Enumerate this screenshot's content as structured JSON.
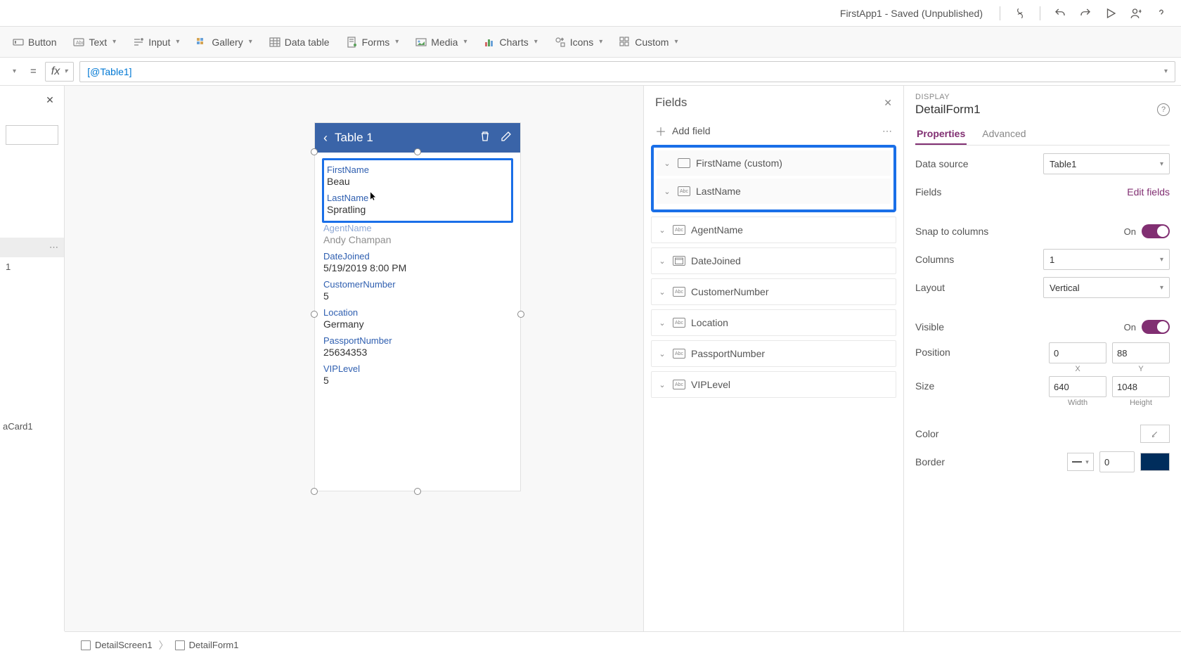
{
  "title_bar": {
    "app_title": "FirstApp1 - Saved (Unpublished)"
  },
  "ribbon": {
    "button": "Button",
    "text": "Text",
    "input": "Input",
    "gallery": "Gallery",
    "data_table": "Data table",
    "forms": "Forms",
    "media": "Media",
    "charts": "Charts",
    "icons": "Icons",
    "custom": "Custom"
  },
  "formula_bar": {
    "fx": "fx",
    "formula": "[@Table1]"
  },
  "left_panel": {
    "tree_item_1": "1",
    "tree_item_card": "aCard1"
  },
  "canvas": {
    "title": "Table 1",
    "cards": [
      {
        "label": "FirstName",
        "value": "Beau"
      },
      {
        "label": "LastName",
        "value": "Spratling"
      },
      {
        "label": "AgentName",
        "value": "Andy Champan"
      },
      {
        "label": "DateJoined",
        "value": "5/19/2019 8:00 PM"
      },
      {
        "label": "CustomerNumber",
        "value": "5"
      },
      {
        "label": "Location",
        "value": "Germany"
      },
      {
        "label": "PassportNumber",
        "value": "25634353"
      },
      {
        "label": "VIPLevel",
        "value": "5"
      }
    ]
  },
  "fields_panel": {
    "title": "Fields",
    "add_field": "Add field",
    "items": [
      {
        "name": "FirstName (custom)",
        "type": "custom"
      },
      {
        "name": "LastName",
        "type": "abc"
      },
      {
        "name": "AgentName",
        "type": "abc"
      },
      {
        "name": "DateJoined",
        "type": "date"
      },
      {
        "name": "CustomerNumber",
        "type": "abc"
      },
      {
        "name": "Location",
        "type": "abc"
      },
      {
        "name": "PassportNumber",
        "type": "abc"
      },
      {
        "name": "VIPLevel",
        "type": "abc"
      }
    ]
  },
  "props_panel": {
    "display_label": "DISPLAY",
    "name": "DetailForm1",
    "tabs": {
      "properties": "Properties",
      "advanced": "Advanced"
    },
    "data_source": {
      "label": "Data source",
      "value": "Table1"
    },
    "fields": {
      "label": "Fields",
      "edit": "Edit fields"
    },
    "snap": {
      "label": "Snap to columns",
      "value": "On"
    },
    "columns": {
      "label": "Columns",
      "value": "1"
    },
    "layout": {
      "label": "Layout",
      "value": "Vertical"
    },
    "visible": {
      "label": "Visible",
      "value": "On"
    },
    "position": {
      "label": "Position",
      "x": "0",
      "y": "88",
      "xlabel": "X",
      "ylabel": "Y"
    },
    "size": {
      "label": "Size",
      "w": "640",
      "h": "1048",
      "wlabel": "Width",
      "hlabel": "Height"
    },
    "color": {
      "label": "Color"
    },
    "border": {
      "label": "Border",
      "value": "0"
    }
  },
  "breadcrumb": {
    "screen": "DetailScreen1",
    "form": "DetailForm1"
  }
}
